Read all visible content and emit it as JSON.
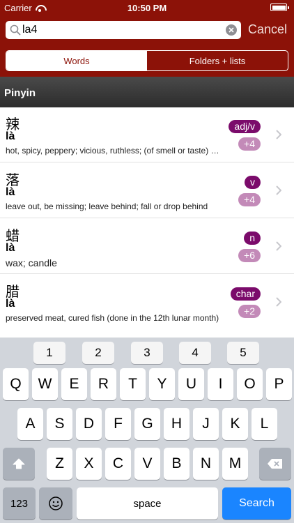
{
  "status_bar": {
    "carrier": "Carrier",
    "time": "10:50 PM"
  },
  "search": {
    "value": "la4",
    "placeholder": "",
    "cancel_label": "Cancel"
  },
  "tabs": [
    {
      "label": "Words",
      "active": true
    },
    {
      "label": "Folders + lists",
      "active": false
    }
  ],
  "section": {
    "title": "Pinyin"
  },
  "results": [
    {
      "hanzi": "辣",
      "pinyin": "là",
      "definition": "hot, spicy, peppery; vicious, ruthless; (of smell or taste) burn,...",
      "pos": "adj/v",
      "count": "+4"
    },
    {
      "hanzi": "落",
      "pinyin": "là",
      "definition": "leave out, be missing; leave behind; fall or drop behind",
      "pos": "v",
      "count": "+4"
    },
    {
      "hanzi": "蜡",
      "pinyin": "là",
      "definition": "wax; candle",
      "pos": "n",
      "count": "+6"
    },
    {
      "hanzi": "腊",
      "pinyin": "là",
      "definition": "preserved meat, cured fish (done in the 12th lunar month)",
      "pos": "char",
      "count": "+2"
    }
  ],
  "keyboard": {
    "numbers": [
      "1",
      "2",
      "3",
      "4",
      "5"
    ],
    "row1": [
      "Q",
      "W",
      "E",
      "R",
      "T",
      "Y",
      "U",
      "I",
      "O",
      "P"
    ],
    "row2": [
      "A",
      "S",
      "D",
      "F",
      "G",
      "H",
      "J",
      "K",
      "L"
    ],
    "row3": [
      "Z",
      "X",
      "C",
      "V",
      "B",
      "N",
      "M"
    ],
    "numbers_key": "123",
    "space_label": "space",
    "search_label": "Search"
  },
  "colors": {
    "header": "#8c1208",
    "pos_badge": "#7b0b6b",
    "count_badge": "#c38ab8",
    "search_key": "#1a85ff"
  }
}
